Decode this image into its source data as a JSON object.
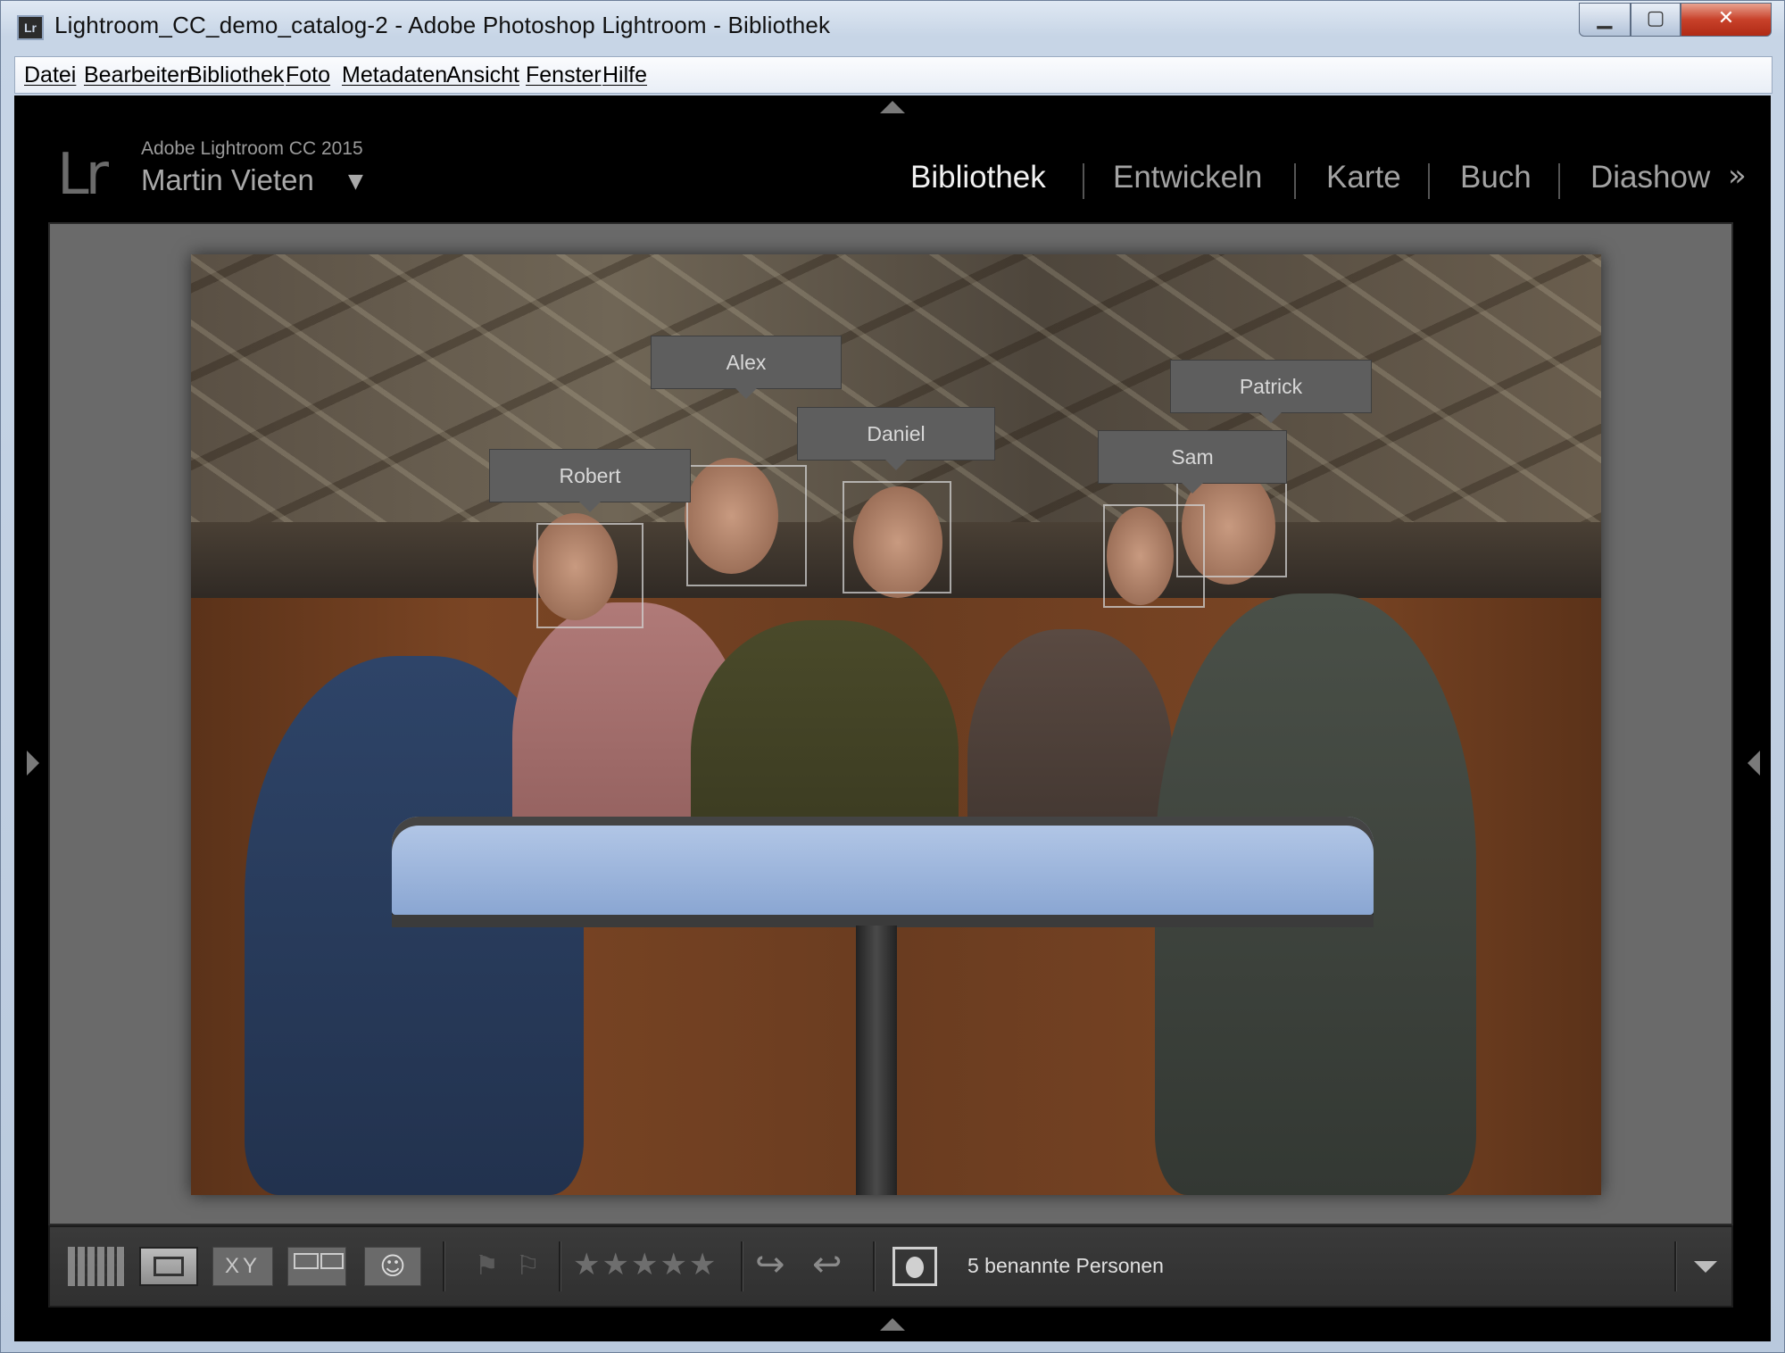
{
  "window": {
    "title": "Lightroom_CC_demo_catalog-2 - Adobe Photoshop Lightroom - Bibliothek",
    "icon_label": "Lr",
    "min_glyph": "▁",
    "max_glyph": "▢",
    "close_glyph": "✕"
  },
  "menu": {
    "items": [
      "Datei",
      "Bearbeiten",
      "Bibliothek",
      "Foto",
      "Metadaten",
      "Ansicht",
      "Fenster",
      "Hilfe"
    ]
  },
  "identity": {
    "logo": "Lr",
    "product": "Adobe Lightroom CC 2015",
    "user": "Martin Vieten",
    "caret": "▼"
  },
  "modules": {
    "items": [
      "Bibliothek",
      "Entwickeln",
      "Karte",
      "Buch",
      "Diashow"
    ],
    "active": "Bibliothek",
    "more_glyph": "»"
  },
  "faces": [
    {
      "name": "Alex"
    },
    {
      "name": "Daniel"
    },
    {
      "name": "Patrick"
    },
    {
      "name": "Robert"
    },
    {
      "name": "Sam"
    }
  ],
  "toolbar": {
    "compare_label": "XY",
    "people_glyph": "☺",
    "flag_pick_glyph": "⚑",
    "flag_reject_glyph": "⚐",
    "stars": "★★★★★",
    "rotate_left_glyph": "↪",
    "rotate_right_glyph": "↩",
    "named_count": "5 benannte Personen"
  },
  "colors": {
    "lr_background": "#000000",
    "loupe_background": "#6a6a6a",
    "face_tag": "#5e5e5e",
    "active_module": "#f2f2f2",
    "inactive_module": "#a3a3a3"
  }
}
